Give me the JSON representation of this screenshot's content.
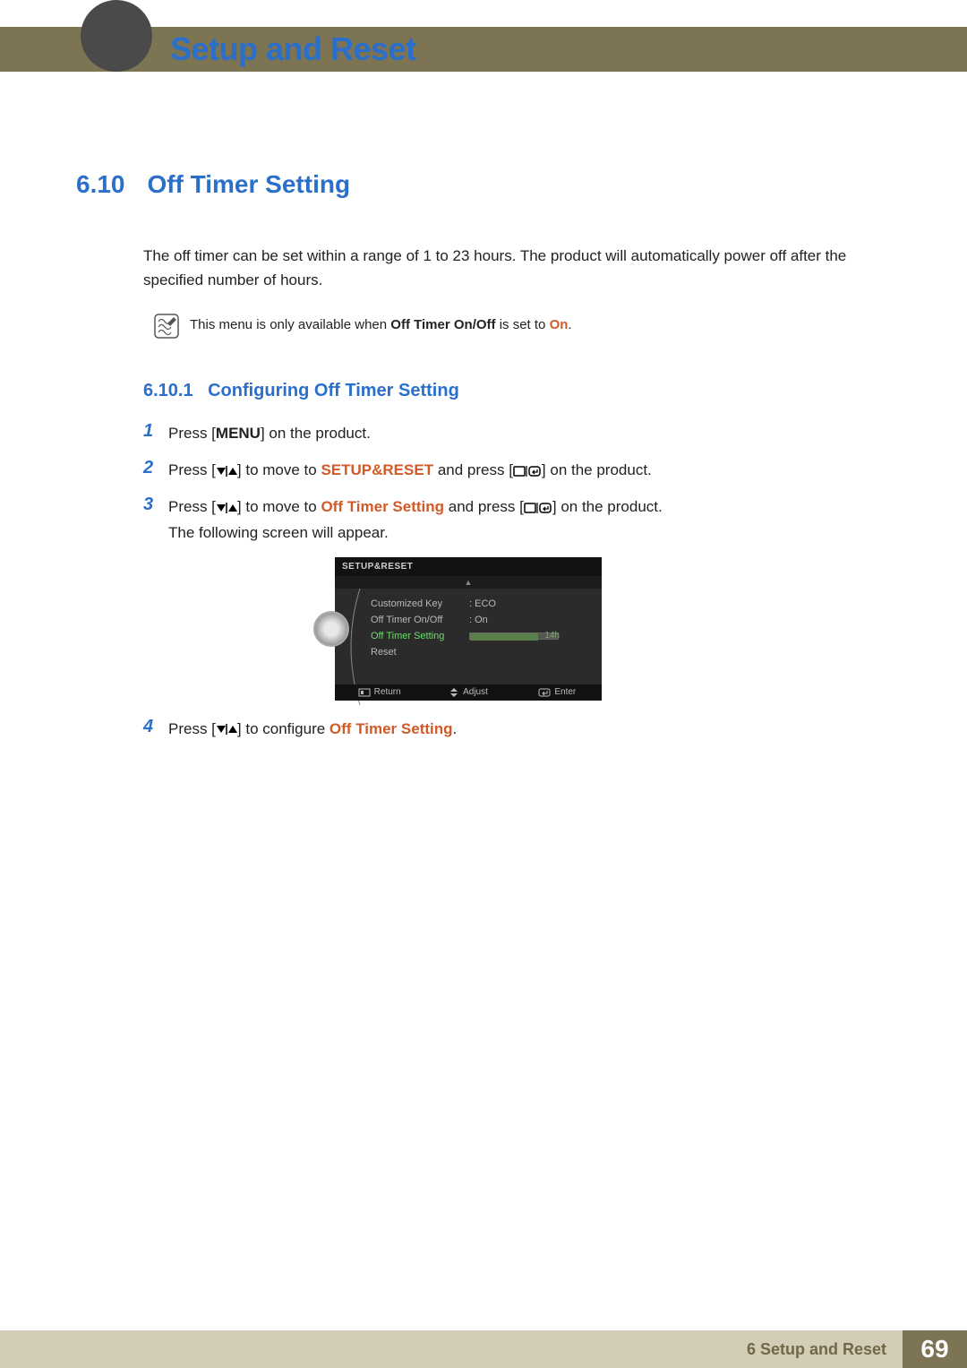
{
  "header": {
    "chapter_title": "Setup and Reset"
  },
  "section": {
    "number": "6.10",
    "title": "Off Timer Setting",
    "description": "The off timer can be set within a range of 1 to 23 hours. The product will automatically power off after the specified number of hours."
  },
  "note": {
    "prefix": "This menu is only available when ",
    "key": "Off Timer On/Off",
    "mid": " is set to ",
    "value": "On",
    "suffix": "."
  },
  "subsection": {
    "number": "6.10.1",
    "title": "Configuring Off Timer Setting"
  },
  "steps": {
    "s1": {
      "num": "1",
      "a": "Press [",
      "b": "MENU",
      "c": "] on the product."
    },
    "s2": {
      "num": "2",
      "a": "Press [",
      "b": "] to move to ",
      "c": "SETUP&RESET",
      "d": " and press [",
      "e": "] on the product."
    },
    "s3": {
      "num": "3",
      "a": "Press [",
      "b": "] to move to ",
      "c": "Off Timer Setting",
      "d": " and press [",
      "e": "] on the product.",
      "f": "The following screen will appear."
    },
    "s4": {
      "num": "4",
      "a": "Press [",
      "b": "] to configure ",
      "c": "Off Timer Setting",
      "d": "."
    }
  },
  "osd": {
    "title": "SETUP&RESET",
    "rows": {
      "r1": {
        "label": "Customized Key",
        "val": ":  ECO"
      },
      "r2": {
        "label": "Off Timer On/Off",
        "val": ":  On"
      },
      "r3": {
        "label": "Off Timer Setting",
        "val": "14h"
      },
      "r4": {
        "label": "Reset",
        "val": ""
      }
    },
    "footer": {
      "return": "Return",
      "adjust": "Adjust",
      "enter": "Enter"
    }
  },
  "footer": {
    "text": "6 Setup and Reset",
    "page": "69"
  }
}
